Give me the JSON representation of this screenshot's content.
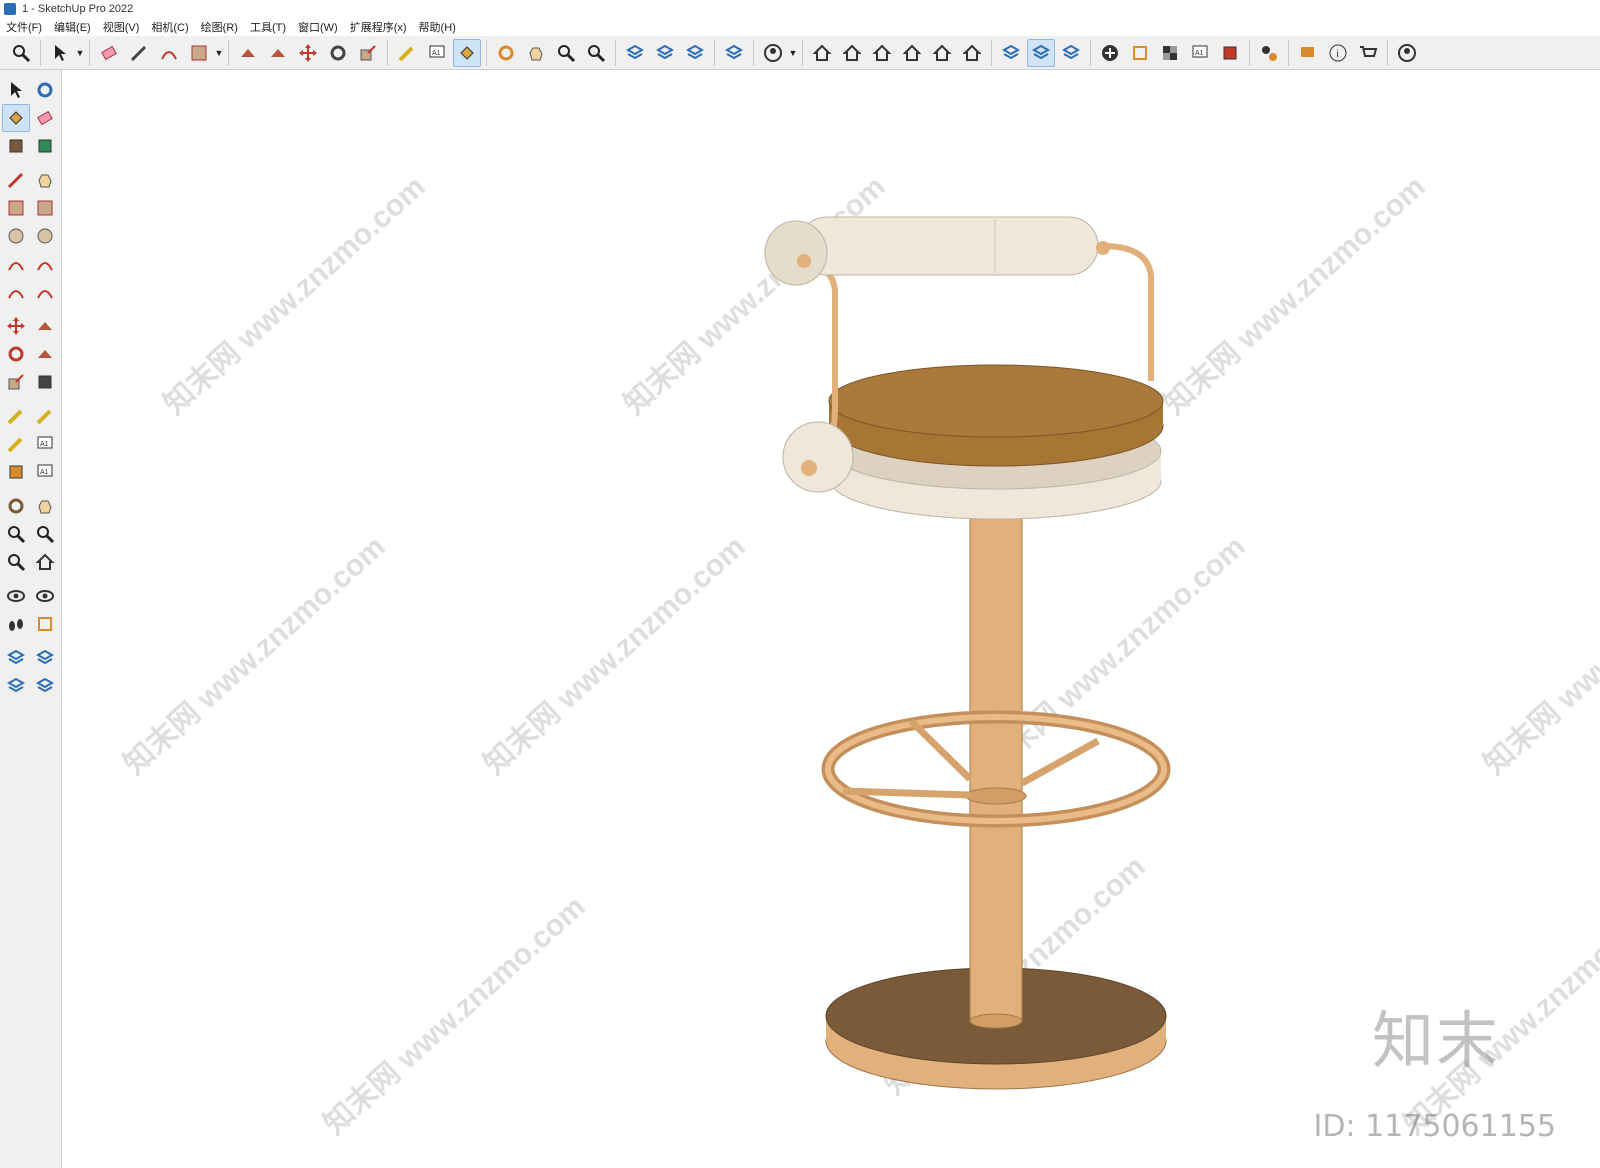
{
  "window": {
    "title": "1 - SketchUp Pro 2022"
  },
  "menus": [
    "文件(F)",
    "编辑(E)",
    "视图(V)",
    "相机(C)",
    "绘图(R)",
    "工具(T)",
    "窗口(W)",
    "扩展程序(x)",
    "帮助(H)"
  ],
  "toolbar": {
    "groups": [
      [
        "zoom-icon"
      ],
      [
        "select-icon"
      ],
      [
        "eraser-icon",
        "pencil-icon",
        "arc-icon",
        "rectangle-icon"
      ],
      [
        "push-pull-icon",
        "follow-me-icon",
        "move-icon",
        "rotate-icon",
        "scale-icon"
      ],
      [
        "tape-measure-icon",
        "text-icon",
        "paint-bucket-icon"
      ],
      [
        "orbit-icon",
        "pan-icon",
        "zoom-tool-icon",
        "zoom-extents-icon"
      ],
      [
        "sandbox-icon",
        "sandbox-smoove-icon",
        "sandbox-stamp-icon"
      ],
      [
        "sandbox-drape-icon"
      ],
      [
        "user-icon"
      ],
      [
        "iso-view-icon",
        "front-view-icon",
        "home-view-icon",
        "top-view-icon",
        "right-view-icon",
        "back-view-icon"
      ],
      [
        "components-icon",
        "outliner-icon",
        "styles-icon"
      ],
      [
        "add-location-icon",
        "section-plane-icon",
        "materials-icon",
        "texture-icon",
        "trimble-connect-icon"
      ],
      [
        "extension-manager-icon"
      ],
      [
        "chat-icon",
        "info-icon",
        "cart-icon"
      ],
      [
        "account-icon"
      ]
    ],
    "active": [
      "paint-bucket-icon",
      "outliner-icon"
    ]
  },
  "sidebar": {
    "groups": [
      [
        "select-icon",
        "orbit-icon",
        "paint-bucket-icon",
        "eraser-icon",
        "make-component-icon",
        "tag-icon"
      ],
      [
        "pencil-icon",
        "freehand-icon",
        "rectangle-icon",
        "rotated-rectangle-icon",
        "circle-icon",
        "polygon-icon",
        "arc-icon",
        "2-point-arc-icon",
        "3-point-arc-icon",
        "pie-icon"
      ],
      [
        "move-icon",
        "push-pull-icon",
        "rotate-icon",
        "follow-me-icon",
        "scale-icon",
        "offset-icon"
      ],
      [
        "tape-measure-icon",
        "dimension-icon",
        "protractor-icon",
        "text-icon",
        "axes-icon",
        "3d-text-icon"
      ],
      [
        "orbit-tool-icon",
        "pan-icon",
        "zoom-icon",
        "zoom-window-icon",
        "zoom-extents-icon",
        "previous-view-icon"
      ],
      [
        "position-camera-icon",
        "look-around-icon",
        "walk-icon",
        "section-plane-icon"
      ],
      [
        "sandbox-from-contours-icon",
        "sandbox-from-scratch-icon",
        "sandbox-smoove-icon",
        "sandbox-stamp-icon"
      ]
    ],
    "active": [
      "paint-bucket-icon"
    ]
  },
  "viewport": {
    "watermark_text": "知末网 www.znzmo.com",
    "brand_logo": "知末",
    "id_label": "ID: 1175061155"
  },
  "colors": {
    "wood": "#e2b07a",
    "wood_dark": "#bf8a55",
    "base_top": "#7a5a38",
    "seat": "#a87634",
    "cushion": "#efe7da",
    "cushion_shade": "#d9cfbf"
  }
}
